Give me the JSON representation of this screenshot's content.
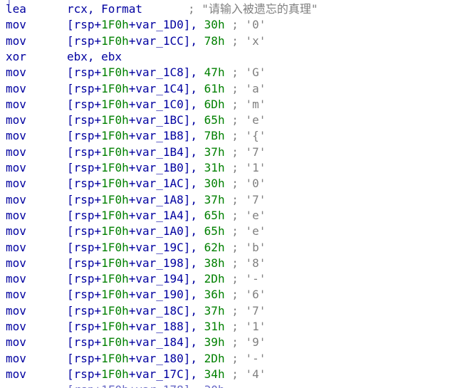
{
  "lines": [
    {
      "mnemonic": "lea",
      "operands": "rcx, Format",
      "comment": "; \"请输入被遗忘的真理\""
    },
    {
      "mnemonic": "mov",
      "pre": "[rsp+",
      "base": "1F0h",
      "var": "+var_1D0], ",
      "imm": "30h",
      "comment": " ; '0'"
    },
    {
      "mnemonic": "mov",
      "pre": "[rsp+",
      "base": "1F0h",
      "var": "+var_1CC], ",
      "imm": "78h",
      "comment": " ; 'x'"
    },
    {
      "mnemonic": "xor",
      "operands": "ebx, ebx"
    },
    {
      "mnemonic": "mov",
      "pre": "[rsp+",
      "base": "1F0h",
      "var": "+var_1C8], ",
      "imm": "47h",
      "comment": " ; 'G'"
    },
    {
      "mnemonic": "mov",
      "pre": "[rsp+",
      "base": "1F0h",
      "var": "+var_1C4], ",
      "imm": "61h",
      "comment": " ; 'a'"
    },
    {
      "mnemonic": "mov",
      "pre": "[rsp+",
      "base": "1F0h",
      "var": "+var_1C0], ",
      "imm": "6Dh",
      "comment": " ; 'm'"
    },
    {
      "mnemonic": "mov",
      "pre": "[rsp+",
      "base": "1F0h",
      "var": "+var_1BC], ",
      "imm": "65h",
      "comment": " ; 'e'"
    },
    {
      "mnemonic": "mov",
      "pre": "[rsp+",
      "base": "1F0h",
      "var": "+var_1B8], ",
      "imm": "7Bh",
      "comment": " ; '{'"
    },
    {
      "mnemonic": "mov",
      "pre": "[rsp+",
      "base": "1F0h",
      "var": "+var_1B4], ",
      "imm": "37h",
      "comment": " ; '7'"
    },
    {
      "mnemonic": "mov",
      "pre": "[rsp+",
      "base": "1F0h",
      "var": "+var_1B0], ",
      "imm": "31h",
      "comment": " ; '1'"
    },
    {
      "mnemonic": "mov",
      "pre": "[rsp+",
      "base": "1F0h",
      "var": "+var_1AC], ",
      "imm": "30h",
      "comment": " ; '0'"
    },
    {
      "mnemonic": "mov",
      "pre": "[rsp+",
      "base": "1F0h",
      "var": "+var_1A8], ",
      "imm": "37h",
      "comment": " ; '7'"
    },
    {
      "mnemonic": "mov",
      "pre": "[rsp+",
      "base": "1F0h",
      "var": "+var_1A4], ",
      "imm": "65h",
      "comment": " ; 'e'"
    },
    {
      "mnemonic": "mov",
      "pre": "[rsp+",
      "base": "1F0h",
      "var": "+var_1A0], ",
      "imm": "65h",
      "comment": " ; 'e'"
    },
    {
      "mnemonic": "mov",
      "pre": "[rsp+",
      "base": "1F0h",
      "var": "+var_19C], ",
      "imm": "62h",
      "comment": " ; 'b'"
    },
    {
      "mnemonic": "mov",
      "pre": "[rsp+",
      "base": "1F0h",
      "var": "+var_198], ",
      "imm": "38h",
      "comment": " ; '8'"
    },
    {
      "mnemonic": "mov",
      "pre": "[rsp+",
      "base": "1F0h",
      "var": "+var_194], ",
      "imm": "2Dh",
      "comment": " ; '-'"
    },
    {
      "mnemonic": "mov",
      "pre": "[rsp+",
      "base": "1F0h",
      "var": "+var_190], ",
      "imm": "36h",
      "comment": " ; '6'"
    },
    {
      "mnemonic": "mov",
      "pre": "[rsp+",
      "base": "1F0h",
      "var": "+var_18C], ",
      "imm": "37h",
      "comment": " ; '7'"
    },
    {
      "mnemonic": "mov",
      "pre": "[rsp+",
      "base": "1F0h",
      "var": "+var_188], ",
      "imm": "31h",
      "comment": " ; '1'"
    },
    {
      "mnemonic": "mov",
      "pre": "[rsp+",
      "base": "1F0h",
      "var": "+var_184], ",
      "imm": "39h",
      "comment": " ; '9'"
    },
    {
      "mnemonic": "mov",
      "pre": "[rsp+",
      "base": "1F0h",
      "var": "+var_180], ",
      "imm": "2Dh",
      "comment": " ; '-'"
    },
    {
      "mnemonic": "mov",
      "pre": "[rsp+",
      "base": "1F0h",
      "var": "+var_17C], ",
      "imm": "34h",
      "comment": " ; '4'"
    }
  ],
  "colors": {
    "code": "#0000a0",
    "immediate": "#008000",
    "comment": "#808080",
    "highlight_border": "#f0c86e"
  }
}
